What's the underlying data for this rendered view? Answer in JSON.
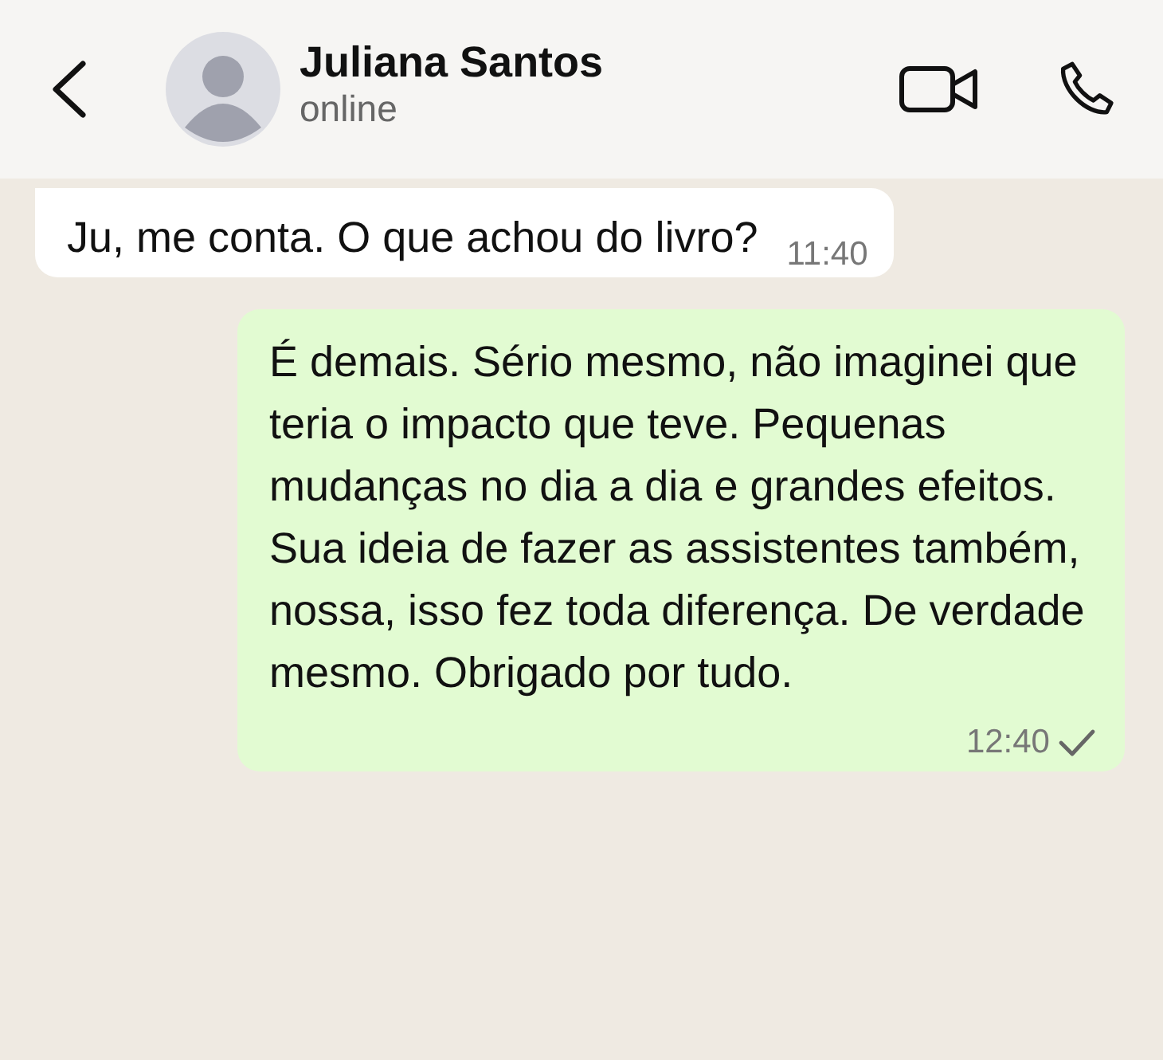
{
  "header": {
    "title": "Juliana Santos",
    "status": "online"
  },
  "messages": [
    {
      "kind": "incoming",
      "text": "Ju, me conta. O que achou do livro?",
      "time": "11:40"
    },
    {
      "kind": "outgoing",
      "text": "É demais. Sério mesmo, não imaginei que teria o impacto que teve. Pequenas mudanças no dia a dia e grandes efeitos. Sua ideia de fazer as assistentes também, nossa, isso fez toda diferença. De verdade mesmo. Obrigado por tudo.",
      "time": "12:40",
      "read": false
    }
  ]
}
